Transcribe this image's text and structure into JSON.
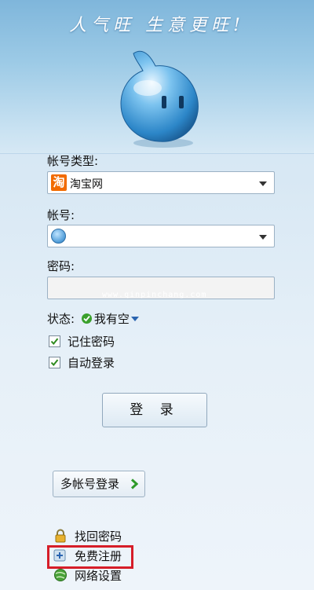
{
  "header": {
    "slogan": "人气旺 生意更旺!"
  },
  "account_type": {
    "label": "帐号类型:",
    "value": "淘宝网",
    "icon": "taobao-icon",
    "icon_text": "淘"
  },
  "account": {
    "label": "帐号:",
    "value": "",
    "icon": "user-avatar-icon"
  },
  "password": {
    "label": "密码:",
    "value": ""
  },
  "watermark": "www.qinpinchang.com",
  "status": {
    "label": "状态:",
    "value": "我有空"
  },
  "options": {
    "remember_password": "记住密码",
    "auto_login": "自动登录"
  },
  "login_button": "登 录",
  "multi_login_button": "多帐号登录",
  "links": {
    "recover_password": "找回密码",
    "free_register": "免费注册",
    "network_settings": "网络设置"
  },
  "colors": {
    "accent": "#2a64b0",
    "highlight": "#d61d28",
    "online": "#3aa02c",
    "taobao": "#f26b00"
  }
}
